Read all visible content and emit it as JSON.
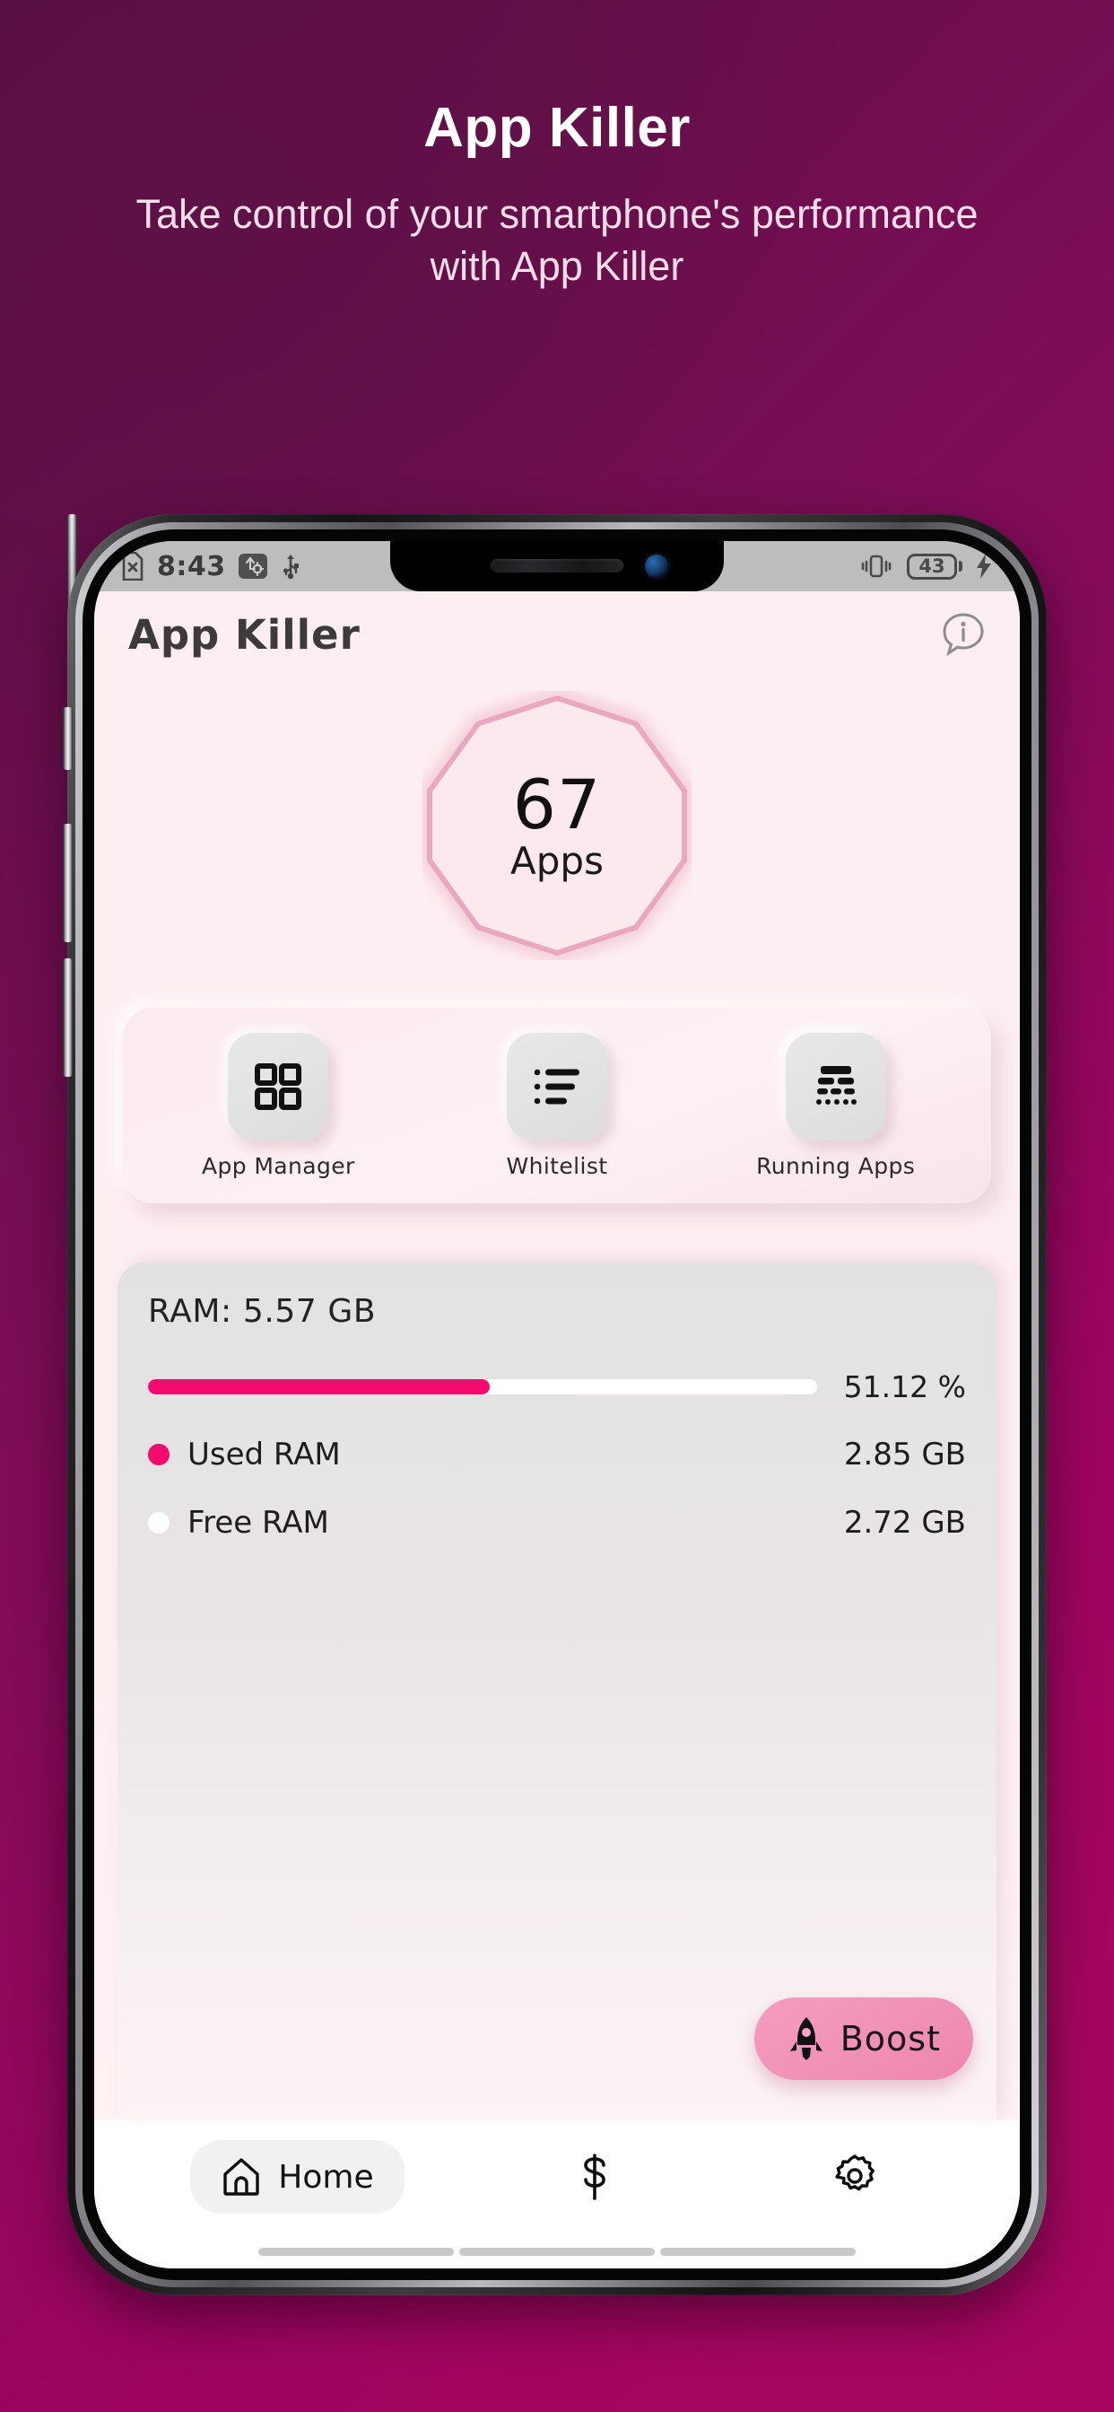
{
  "promo": {
    "title": "App Killer",
    "subtitle": "Take control of your smartphone's performance with App Killer"
  },
  "status_bar": {
    "time": "8:43",
    "battery_level": "43",
    "icons": [
      "no-sim-icon",
      "usb-debug-icon",
      "usb-icon",
      "vibrate-icon",
      "battery-icon",
      "charging-bolt-icon"
    ]
  },
  "app_bar": {
    "title": "App Killer",
    "info_icon": "info-bubble-icon"
  },
  "counter": {
    "value": "67",
    "label": "Apps"
  },
  "actions": [
    {
      "label": "App Manager",
      "icon": "grid-icon"
    },
    {
      "label": "Whitelist",
      "icon": "bullet-list-icon"
    },
    {
      "label": "Running Apps",
      "icon": "stacked-list-icon"
    }
  ],
  "ram": {
    "title": "RAM: 5.57 GB",
    "percent_label": "51.12 %",
    "percent_value": 51.12,
    "rows": [
      {
        "label": "Used RAM",
        "value": "2.85 GB",
        "color": "#f40a6d"
      },
      {
        "label": "Free RAM",
        "value": "2.72 GB",
        "color": "#ffffff"
      }
    ]
  },
  "boost": {
    "label": "Boost",
    "icon": "rocket-icon"
  },
  "bottom_nav": [
    {
      "label": "Home",
      "icon": "home-icon",
      "active": true
    },
    {
      "label": "",
      "icon": "dollar-icon",
      "active": false
    },
    {
      "label": "",
      "icon": "gear-icon",
      "active": false
    }
  ],
  "colors": {
    "accent": "#f40a6d",
    "boost": "#f293b9",
    "screen_bg": "#fdeef1",
    "promo_bg": "#7a0d55"
  }
}
